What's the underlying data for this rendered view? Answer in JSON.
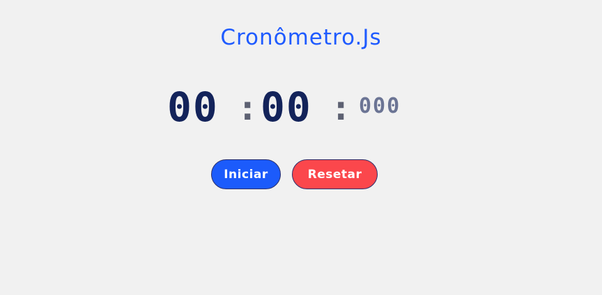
{
  "header": {
    "title": "Cronômetro.Js"
  },
  "timer": {
    "minutes": "00",
    "separator_1": ":",
    "seconds": "00",
    "separator_2": ":",
    "milliseconds": "000"
  },
  "controls": {
    "start_label": "Iniciar",
    "reset_label": "Resetar"
  },
  "colors": {
    "accent": "#1f5bff",
    "digit": "#13235a",
    "milliseconds": "#6b7494",
    "separator": "#5d6172",
    "start_button": "#1c5bfb",
    "reset_button": "#fb474c",
    "background": "#f1f1f1"
  }
}
